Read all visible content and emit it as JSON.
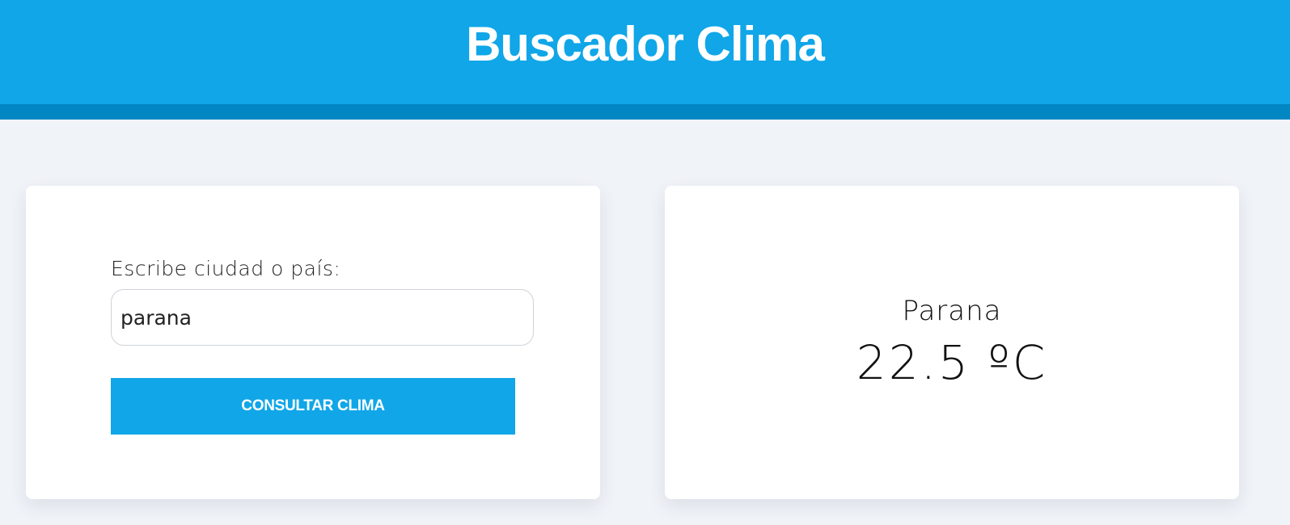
{
  "header": {
    "title": "Buscador Clima"
  },
  "form": {
    "label": "Escribe ciudad o país:",
    "input_value": "parana",
    "button_label": "CONSULTAR CLIMA"
  },
  "result": {
    "city": "Parana",
    "temperature": "22.5 ºC"
  },
  "colors": {
    "primary": "#10a6e8",
    "primary_dark": "#0287c3",
    "background": "#f0f3f8",
    "card": "#ffffff"
  }
}
